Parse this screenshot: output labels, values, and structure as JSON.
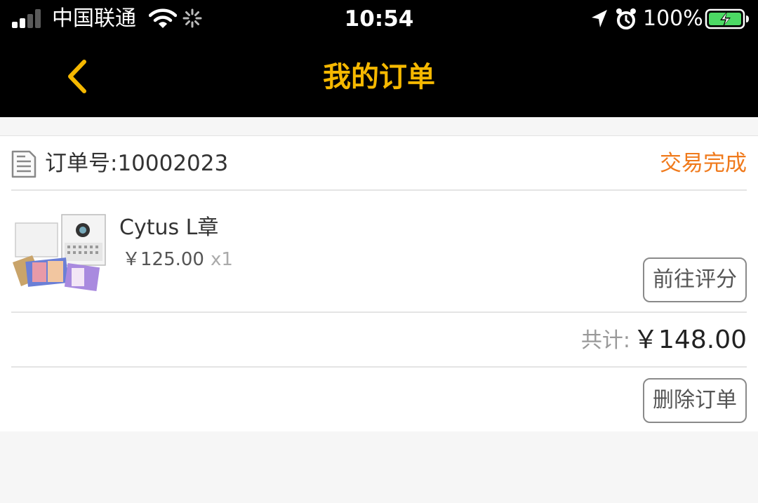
{
  "status_bar": {
    "carrier": "中国联通",
    "time": "10:54",
    "battery_percent": "100%",
    "signal_bars": 4,
    "signal_bars_active": 2,
    "battery_level": 1.0,
    "battery_color": "#4cd964",
    "icons": [
      "signal-icon",
      "wifi-icon",
      "loading-spinner-icon",
      "location-arrow-icon",
      "alarm-clock-icon",
      "battery-charging-icon"
    ]
  },
  "nav": {
    "back_icon": "chevron-left-icon",
    "title": "我的订单",
    "accent_color": "#f5b800"
  },
  "order": {
    "icon": "document-icon",
    "order_number_label": "订单号:10002023",
    "status": "交易完成",
    "status_color": "#f07a1c",
    "item": {
      "image": "product-thumbnail",
      "name": "Cytus L章",
      "price": "￥125.00",
      "quantity": "x1",
      "review_button": "前往评分"
    },
    "total_label": "共计:",
    "total_value": "￥148.00",
    "delete_button": "删除订单"
  }
}
